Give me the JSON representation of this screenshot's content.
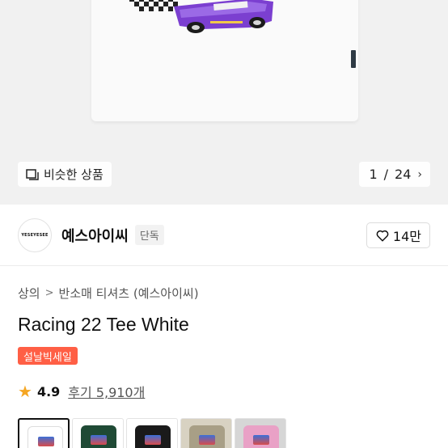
{
  "hero": {
    "similar_label": "비슷한 상품",
    "pager_current": "1",
    "pager_separator": "/",
    "pager_total": "24"
  },
  "brand": {
    "logo_text": "YESEYESEE",
    "name": "예스아이씨",
    "badge": "단독",
    "likes": "14만"
  },
  "breadcrumb": {
    "items": [
      "상의",
      "반소매 티셔츠 (예스아이씨)"
    ]
  },
  "product": {
    "title": "Racing 22 Tee White",
    "sale_badge": "설날빅세일",
    "rating": "4.9",
    "reviews": "후기 5,910개"
  },
  "colors": {
    "thumbs": [
      {
        "name": "white",
        "color": "#ffffff",
        "selected": true
      },
      {
        "name": "green",
        "color": "#1f4a35",
        "selected": false
      },
      {
        "name": "black",
        "color": "#1a1a1a",
        "selected": false
      },
      {
        "name": "camo",
        "color": "#a89f86",
        "selected": false
      },
      {
        "name": "pink",
        "color": "#e9a1c6",
        "selected": false
      }
    ]
  },
  "theme": {
    "sale_color": "#ff5f45",
    "star_color": "#f5a623",
    "car_color": "#7b3fd0"
  }
}
